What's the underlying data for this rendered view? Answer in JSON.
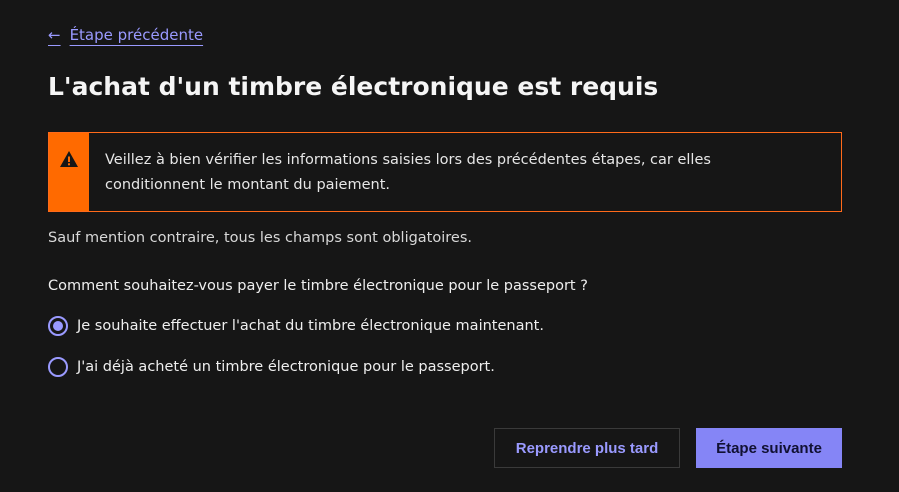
{
  "nav": {
    "back_label": "Étape précédente",
    "back_arrow": "←"
  },
  "page": {
    "title": "L'achat d'un timbre électronique est requis"
  },
  "alert": {
    "icon": "warning-icon",
    "color": "#ff6a00",
    "line1": "Veillez à bien vérifier les informations saisies lors des précédentes étapes, car elles",
    "line2": "conditionnent le montant du paiement."
  },
  "form": {
    "hint": "Sauf mention contraire, tous les champs sont obligatoires.",
    "question": "Comment souhaitez-vous payer le timbre électronique pour le passeport ?",
    "options": [
      {
        "label": "Je souhaite effectuer l'achat du timbre électronique maintenant.",
        "selected": true
      },
      {
        "label": "J'ai déjà acheté un timbre électronique pour le passeport.",
        "selected": false
      }
    ]
  },
  "actions": {
    "later_label": "Reprendre plus tard",
    "next_label": "Étape suivante",
    "accent_color": "#8585f6"
  }
}
